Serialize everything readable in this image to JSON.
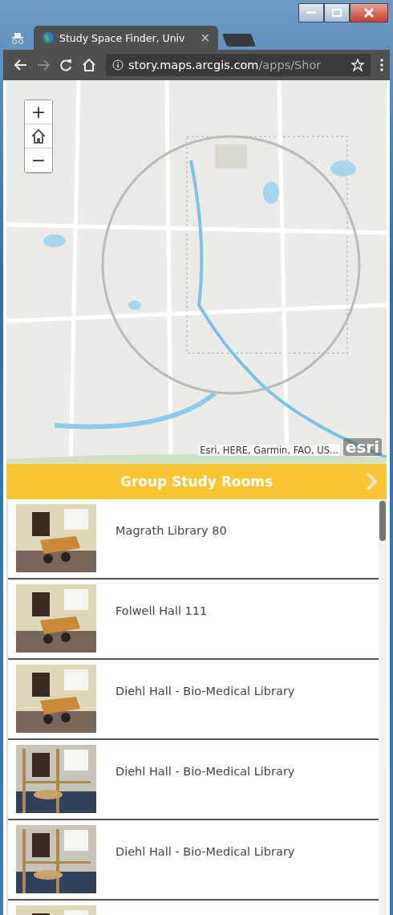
{
  "browser": {
    "tab_title": "Study Space Finder, Univ",
    "tab_close": "×",
    "url_host": "story.maps.arcgis.com",
    "url_path": "/apps/Shor"
  },
  "map": {
    "zoom_in": "+",
    "zoom_out": "−",
    "attribution": "Esri, HERE, Garmin, FAO, US...",
    "logo": "esri"
  },
  "panel": {
    "title": "Group Study Rooms"
  },
  "rooms": [
    {
      "name": "Magrath Library 80",
      "kind": "room"
    },
    {
      "name": "Folwell Hall 111",
      "kind": "room"
    },
    {
      "name": "Diehl Hall - Bio-Medical Library",
      "kind": "room"
    },
    {
      "name": "Diehl Hall - Bio-Medical Library",
      "kind": "glass"
    },
    {
      "name": "Diehl Hall - Bio-Medical Library",
      "kind": "glass"
    },
    {
      "kind": "room"
    }
  ]
}
